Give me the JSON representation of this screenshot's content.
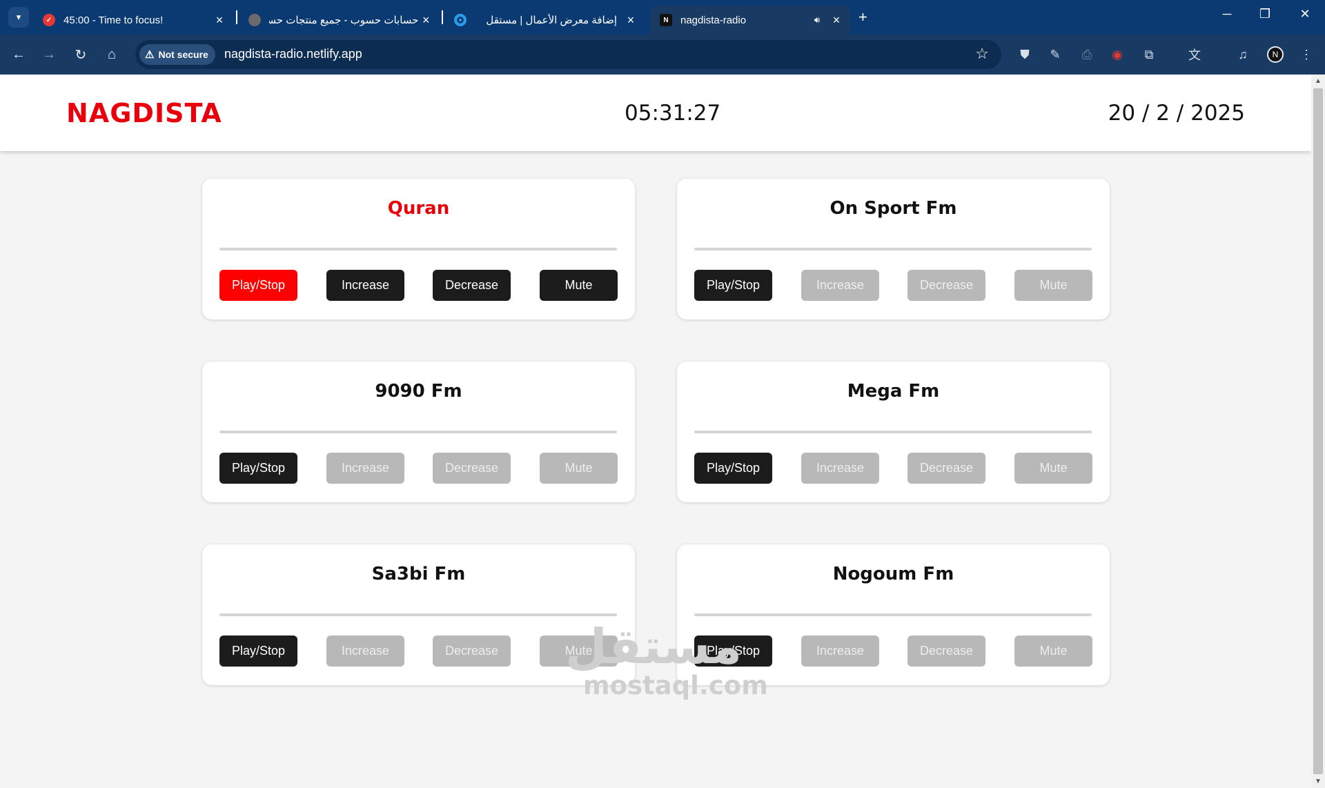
{
  "browser": {
    "tabs": [
      {
        "title": "45:00 - Time to focus!",
        "favicon": "check-circle-icon",
        "favicon_color": "#e53935"
      },
      {
        "title": "حسابات حسوب - جميع منتجات حسوب",
        "favicon": "hsoub-icon",
        "favicon_color": "#6b6b6b"
      },
      {
        "title": "إضافة معرض الأعمال | مستقل",
        "favicon": "mostaql-icon",
        "favicon_color": "#2c9be8"
      },
      {
        "title": "nagdista-radio",
        "favicon": "n-logo-icon",
        "favicon_color": "#111111",
        "active": true,
        "audio": true
      }
    ],
    "security_label": "Not secure",
    "url": "nagdista-radio.netlify.app",
    "profile_initial": "N"
  },
  "header": {
    "logo": "NAGDISTA",
    "time": "05:31:27",
    "date": "20 / 2 / 2025"
  },
  "stations": [
    {
      "name": "Quran",
      "playing": true,
      "controls_enabled": true
    },
    {
      "name": "On Sport Fm",
      "playing": false,
      "controls_enabled": false
    },
    {
      "name": "9090 Fm",
      "playing": false,
      "controls_enabled": false
    },
    {
      "name": "Mega Fm",
      "playing": false,
      "controls_enabled": false
    },
    {
      "name": "Sa3bi Fm",
      "playing": false,
      "controls_enabled": false
    },
    {
      "name": "Nogoum Fm",
      "playing": false,
      "controls_enabled": false
    }
  ],
  "buttons": {
    "play": "Play/Stop",
    "increase": "Increase",
    "decrease": "Decrease",
    "mute": "Mute"
  },
  "watermark": {
    "arabic": "مستقل",
    "latin": "mostaql.com"
  },
  "colors": {
    "brand": "#e8000b",
    "active_button": "#ff0000",
    "button": "#1c1c1c",
    "disabled_button": "#b8b8b8"
  }
}
